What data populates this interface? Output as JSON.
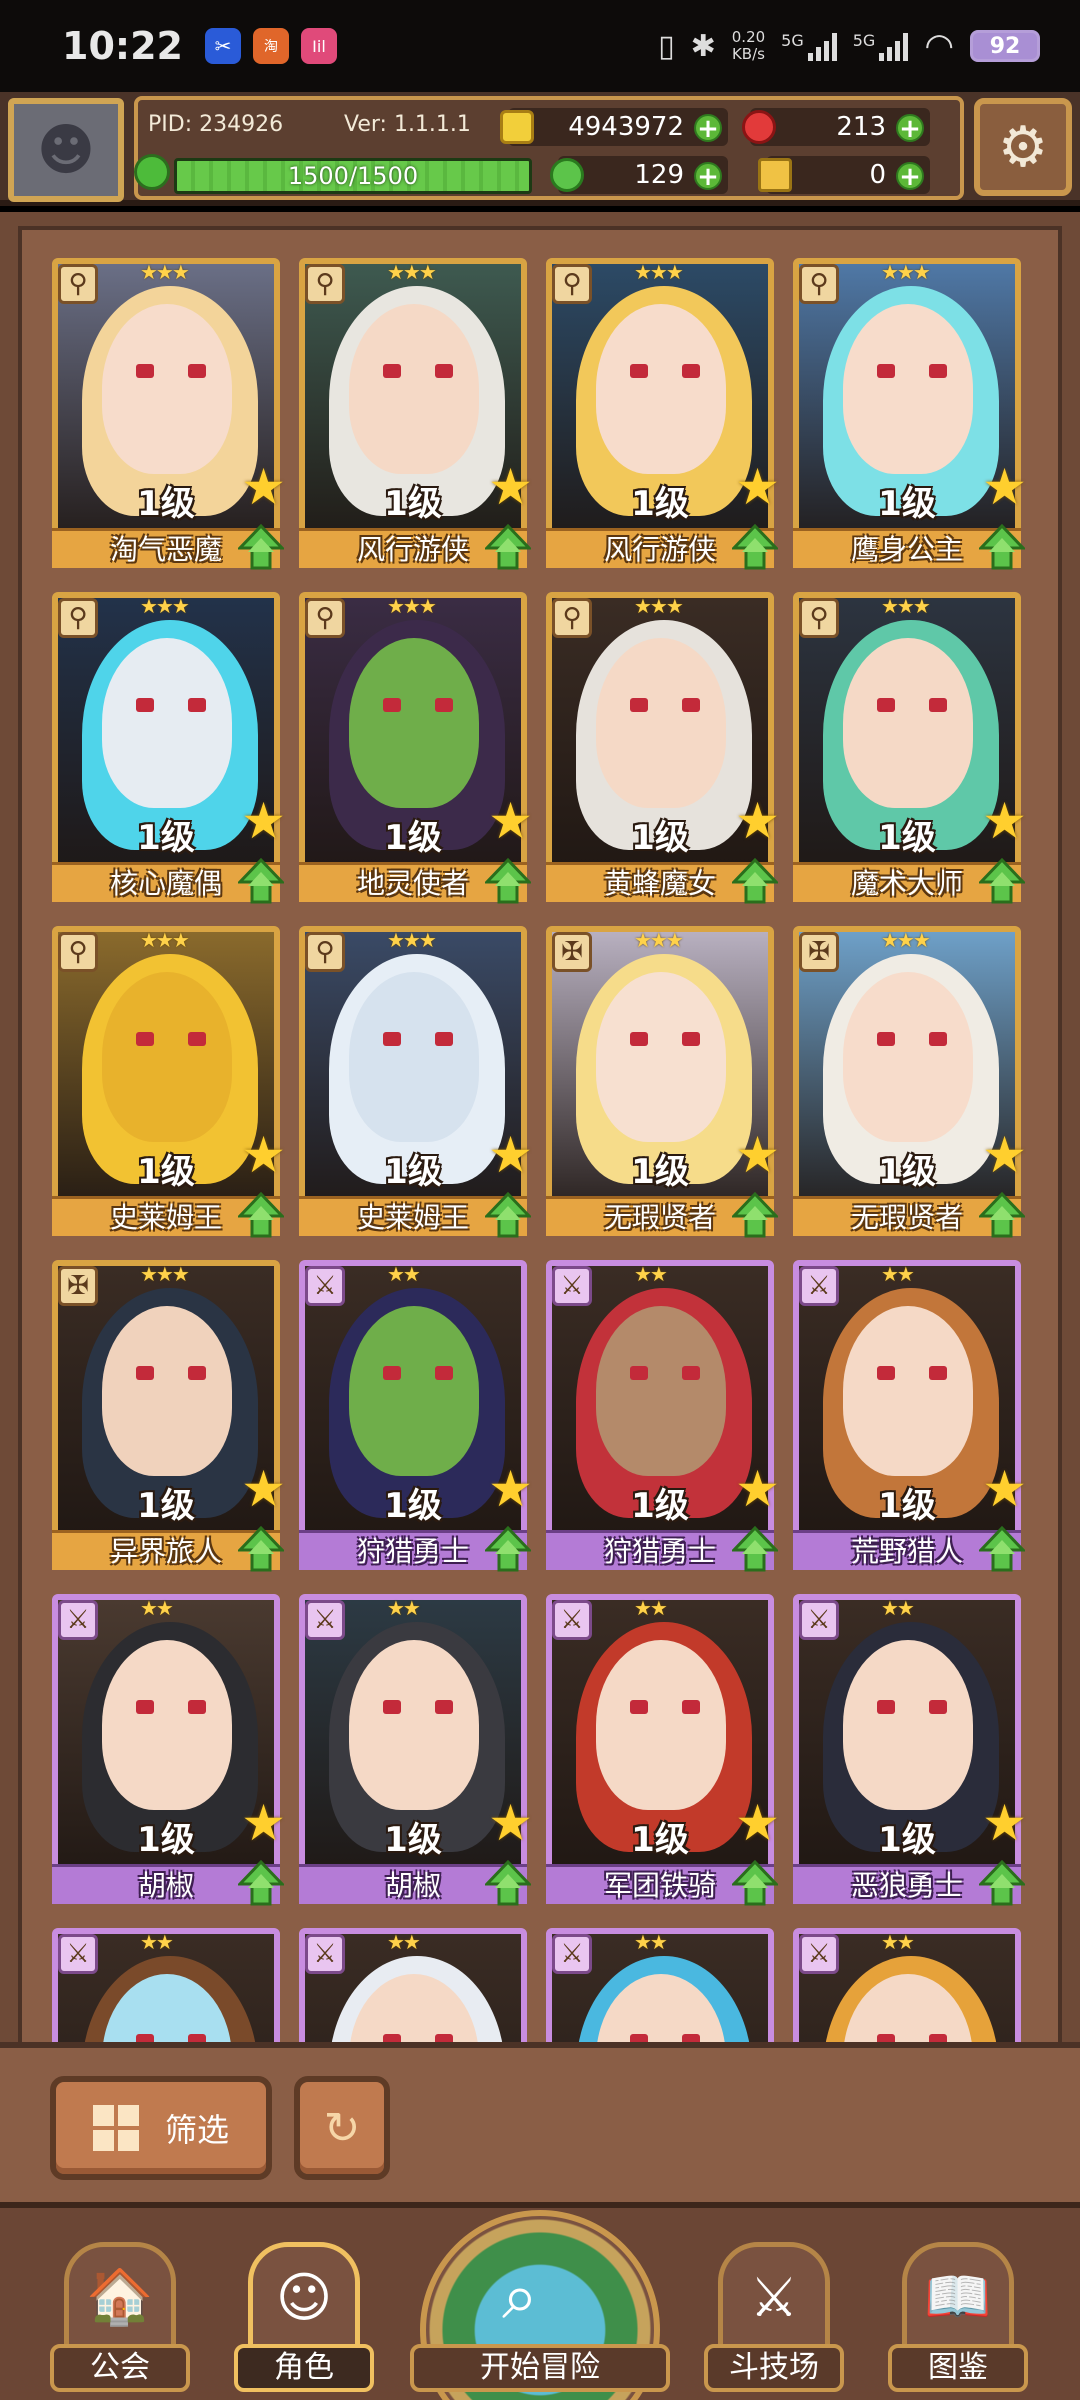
{
  "status_bar": {
    "time": "10:22",
    "apps": [
      {
        "name": "app-icon-blue",
        "color": "#2a5bd8",
        "glyph": "✂"
      },
      {
        "name": "app-icon-orange",
        "color": "#e0662a",
        "glyph": "淘"
      },
      {
        "name": "app-icon-pink",
        "color": "#e04a7a",
        "glyph": "Iil"
      }
    ],
    "net_speed": "0.20",
    "net_unit": "KB/s",
    "sig1": "5G",
    "sig2": "5G",
    "battery": "92"
  },
  "header": {
    "pid": "PID: 234926",
    "version": "Ver: 1.1.1.1",
    "gold": "4943972",
    "gems": "213",
    "energy": "1500/1500",
    "energy_fraction": 1.0,
    "clover": "129",
    "keys": "0"
  },
  "heroes": [
    {
      "level": "1级",
      "name": "淘气恶魔",
      "rarity": "gold",
      "type": "staff",
      "bg": "#6a6f86",
      "hair": "#f3d49a",
      "skin": "#f7dccb"
    },
    {
      "level": "1级",
      "name": "风行游侠",
      "rarity": "gold",
      "type": "staff",
      "bg": "#3e5a50",
      "hair": "#e8e6e0",
      "skin": "#f5d9c6"
    },
    {
      "level": "1级",
      "name": "风行游侠",
      "rarity": "gold",
      "type": "staff",
      "bg": "#2c4a66",
      "hair": "#f2c85a",
      "skin": "#f7dccb"
    },
    {
      "level": "1级",
      "name": "鹰身公主",
      "rarity": "gold",
      "type": "staff",
      "bg": "#4f78a6",
      "hair": "#7de0e6",
      "skin": "#f7dccb"
    },
    {
      "level": "1级",
      "name": "核心魔偶",
      "rarity": "gold",
      "type": "staff",
      "bg": "#22324a",
      "hair": "#4fd4ea",
      "skin": "#e6ecf2"
    },
    {
      "level": "1级",
      "name": "地灵使者",
      "rarity": "gold",
      "type": "wand",
      "bg": "#3a2c44",
      "hair": "#3c2a4a",
      "skin": "#6fae4a"
    },
    {
      "level": "1级",
      "name": "黄蜂魔女",
      "rarity": "gold",
      "type": "wand",
      "bg": "#3a2c24",
      "hair": "#e6e2dc",
      "skin": "#f5d9c6"
    },
    {
      "level": "1级",
      "name": "魔术大师",
      "rarity": "gold",
      "type": "wand",
      "bg": "#2c3440",
      "hair": "#5fc8a8",
      "skin": "#f5d9c6"
    },
    {
      "level": "1级",
      "name": "史莱姆王",
      "rarity": "gold",
      "type": "wand",
      "bg": "#8a6a2c",
      "hair": "#f2c232",
      "skin": "#e8b22c"
    },
    {
      "level": "1级",
      "name": "史莱姆王",
      "rarity": "gold",
      "type": "wand",
      "bg": "#3a4a66",
      "hair": "#e6eef6",
      "skin": "#d6e2ee"
    },
    {
      "level": "1级",
      "name": "无瑕贤者",
      "rarity": "gold",
      "type": "cross",
      "bg": "#b8b0c0",
      "hair": "#f6dc8a",
      "skin": "#f7e0d0"
    },
    {
      "level": "1级",
      "name": "无瑕贤者",
      "rarity": "gold",
      "type": "cross",
      "bg": "#6ea0c8",
      "hair": "#f0ece4",
      "skin": "#f7dccb"
    },
    {
      "level": "1级",
      "name": "异界旅人",
      "rarity": "gold",
      "type": "cross",
      "bg": "#3a2c24",
      "hair": "#2a3444",
      "skin": "#f0d2bc"
    },
    {
      "level": "1级",
      "name": "狩猎勇士",
      "rarity": "purple",
      "type": "sword",
      "bg": "#3a2c24",
      "hair": "#2c2a5a",
      "skin": "#6fae4a"
    },
    {
      "level": "1级",
      "name": "狩猎勇士",
      "rarity": "purple",
      "type": "sword",
      "bg": "#3a2c24",
      "hair": "#c2323a",
      "skin": "#b48a6a"
    },
    {
      "level": "1级",
      "name": "荒野猎人",
      "rarity": "purple",
      "type": "sword",
      "bg": "#3a2c24",
      "hair": "#c2763a",
      "skin": "#f5d9c6"
    },
    {
      "level": "1级",
      "name": "胡椒",
      "rarity": "purple",
      "type": "sword",
      "bg": "#4a3a30",
      "hair": "#2c2c30",
      "skin": "#f5d9c6"
    },
    {
      "level": "1级",
      "name": "胡椒",
      "rarity": "purple",
      "type": "sword",
      "bg": "#2c3a44",
      "hair": "#3a3a40",
      "skin": "#f5d9c6"
    },
    {
      "level": "1级",
      "name": "军团铁骑",
      "rarity": "purple",
      "type": "sword",
      "bg": "#3a2c24",
      "hair": "#c23a2a",
      "skin": "#f5d9c6"
    },
    {
      "level": "1级",
      "name": "恶狼勇士",
      "rarity": "purple",
      "type": "sword",
      "bg": "#3a2c24",
      "hair": "#2a2c3a",
      "skin": "#f5d9c6"
    },
    {
      "level": "",
      "name": "",
      "rarity": "purple",
      "type": "sword",
      "bg": "#3a2c24",
      "hair": "#7a4a2a",
      "skin": "#a8dff0"
    },
    {
      "level": "",
      "name": "",
      "rarity": "purple",
      "type": "sword",
      "bg": "#3a2c24",
      "hair": "#e8ecf2",
      "skin": "#f5d9c6"
    },
    {
      "level": "",
      "name": "",
      "rarity": "purple",
      "type": "sword",
      "bg": "#3a2c24",
      "hair": "#4ab8e0",
      "skin": "#f5d9c6"
    },
    {
      "level": "",
      "name": "",
      "rarity": "purple",
      "type": "sword",
      "bg": "#3a2c24",
      "hair": "#e6a23a",
      "skin": "#f5d9c6"
    }
  ],
  "footer": {
    "filter_label": "筛选"
  },
  "nav": {
    "guild": "公会",
    "character": "角色",
    "adventure": "开始冒险",
    "arena": "斗技场",
    "codex": "图鉴"
  },
  "colors": {
    "gold_frame": "#d9a443",
    "purple_frame": "#c88de0",
    "plus_green": "#5cb838"
  }
}
